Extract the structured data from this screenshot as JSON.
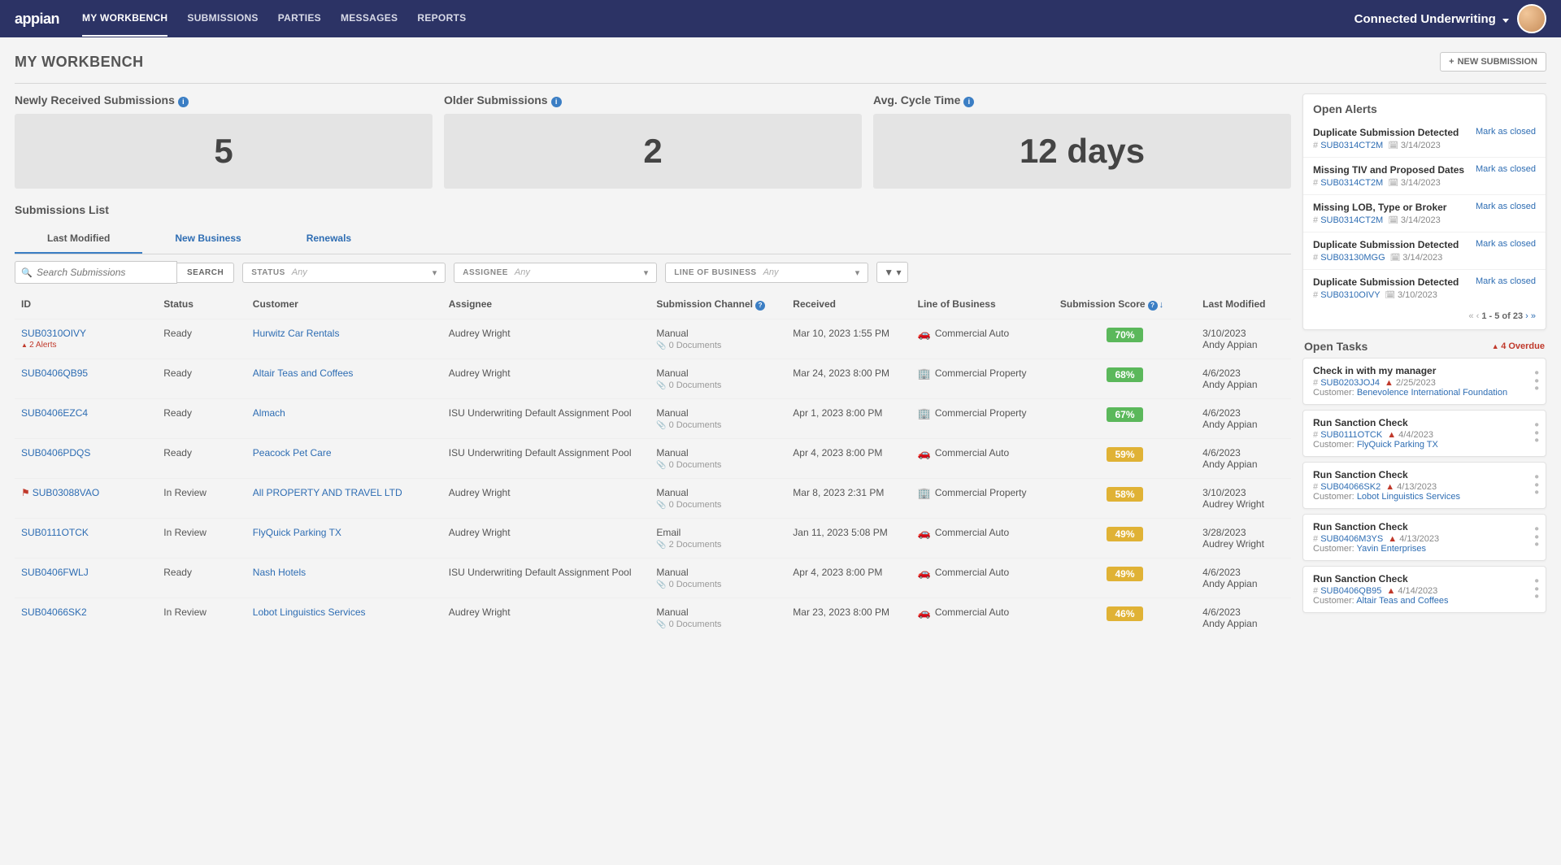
{
  "app": {
    "logo": "appian"
  },
  "nav": {
    "items": [
      {
        "label": "MY WORKBENCH",
        "active": true
      },
      {
        "label": "SUBMISSIONS"
      },
      {
        "label": "PARTIES"
      },
      {
        "label": "MESSAGES"
      },
      {
        "label": "REPORTS"
      }
    ],
    "product": "Connected Underwriting"
  },
  "page": {
    "title": "MY WORKBENCH",
    "new_btn": "NEW SUBMISSION"
  },
  "metrics": {
    "newly": {
      "label": "Newly Received Submissions",
      "value": "5"
    },
    "older": {
      "label": "Older Submissions",
      "value": "2"
    },
    "cycle": {
      "label": "Avg. Cycle Time",
      "value": "12 days"
    }
  },
  "subs": {
    "title": "Submissions List",
    "tabs": [
      {
        "label": "Last Modified",
        "active": true
      },
      {
        "label": "New Business"
      },
      {
        "label": "Renewals"
      }
    ],
    "search_placeholder": "Search Submissions",
    "search_btn": "SEARCH",
    "filters": {
      "status": {
        "label": "STATUS",
        "value": "Any"
      },
      "assignee": {
        "label": "ASSIGNEE",
        "value": "Any"
      },
      "lob": {
        "label": "LINE OF BUSINESS",
        "value": "Any"
      }
    },
    "columns": {
      "id": "ID",
      "status": "Status",
      "customer": "Customer",
      "assignee": "Assignee",
      "channel": "Submission Channel",
      "received": "Received",
      "lob": "Line of Business",
      "score": "Submission Score",
      "modified": "Last Modified"
    },
    "rows": [
      {
        "id": "SUB0310OIVY",
        "alerts": "2 Alerts",
        "status": "Ready",
        "customer": "Hurwitz Car Rentals",
        "assignee": "Audrey Wright",
        "channel": "Manual",
        "docs": "0 Documents",
        "received": "Mar 10, 2023 1:55 PM",
        "lob_icon": "car",
        "lob": "Commercial Auto",
        "score": "70%",
        "score_class": "score-green",
        "mod_date": "3/10/2023",
        "mod_by": "Andy Appian"
      },
      {
        "id": "SUB0406QB95",
        "status": "Ready",
        "customer": "Altair Teas and Coffees",
        "assignee": "Audrey Wright",
        "channel": "Manual",
        "docs": "0 Documents",
        "received": "Mar 24, 2023 8:00 PM",
        "lob_icon": "building",
        "lob": "Commercial Property",
        "score": "68%",
        "score_class": "score-green",
        "mod_date": "4/6/2023",
        "mod_by": "Andy Appian"
      },
      {
        "id": "SUB0406EZC4",
        "status": "Ready",
        "customer": "Almach",
        "assignee": "ISU Underwriting Default Assignment Pool",
        "channel": "Manual",
        "docs": "0 Documents",
        "received": "Apr 1, 2023 8:00 PM",
        "lob_icon": "building",
        "lob": "Commercial Property",
        "score": "67%",
        "score_class": "score-green",
        "mod_date": "4/6/2023",
        "mod_by": "Andy Appian"
      },
      {
        "id": "SUB0406PDQS",
        "status": "Ready",
        "customer": "Peacock Pet Care",
        "assignee": "ISU Underwriting Default Assignment Pool",
        "channel": "Manual",
        "docs": "0 Documents",
        "received": "Apr 4, 2023 8:00 PM",
        "lob_icon": "car",
        "lob": "Commercial Auto",
        "score": "59%",
        "score_class": "score-yellow",
        "mod_date": "4/6/2023",
        "mod_by": "Andy Appian"
      },
      {
        "id": "SUB03088VAO",
        "flag": true,
        "status": "In Review",
        "customer": "All PROPERTY AND TRAVEL LTD",
        "assignee": "Audrey Wright",
        "channel": "Manual",
        "docs": "0 Documents",
        "received": "Mar 8, 2023 2:31 PM",
        "lob_icon": "building",
        "lob": "Commercial Property",
        "score": "58%",
        "score_class": "score-yellow",
        "mod_date": "3/10/2023",
        "mod_by": "Audrey Wright"
      },
      {
        "id": "SUB0111OTCK",
        "status": "In Review",
        "customer": "FlyQuick Parking TX",
        "assignee": "Audrey Wright",
        "channel": "Email",
        "docs": "2 Documents",
        "received": "Jan 11, 2023 5:08 PM",
        "lob_icon": "car",
        "lob": "Commercial Auto",
        "score": "49%",
        "score_class": "score-yellow",
        "mod_date": "3/28/2023",
        "mod_by": "Audrey Wright"
      },
      {
        "id": "SUB0406FWLJ",
        "status": "Ready",
        "customer": "Nash Hotels",
        "assignee": "ISU Underwriting Default Assignment Pool",
        "channel": "Manual",
        "docs": "0 Documents",
        "received": "Apr 4, 2023 8:00 PM",
        "lob_icon": "car",
        "lob": "Commercial Auto",
        "score": "49%",
        "score_class": "score-yellow",
        "mod_date": "4/6/2023",
        "mod_by": "Andy Appian"
      },
      {
        "id": "SUB04066SK2",
        "status": "In Review",
        "customer": "Lobot Linguistics Services",
        "assignee": "Audrey Wright",
        "channel": "Manual",
        "docs": "0 Documents",
        "received": "Mar 23, 2023 8:00 PM",
        "lob_icon": "car",
        "lob": "Commercial Auto",
        "score": "46%",
        "score_class": "score-yellow",
        "mod_date": "4/6/2023",
        "mod_by": "Andy Appian"
      }
    ]
  },
  "alerts": {
    "title": "Open Alerts",
    "mark_closed": "Mark as closed",
    "pagination": "1 - 5 of 23",
    "items": [
      {
        "title": "Duplicate Submission Detected",
        "id": "SUB0314CT2M",
        "date": "3/14/2023"
      },
      {
        "title": "Missing TIV and Proposed Dates",
        "id": "SUB0314CT2M",
        "date": "3/14/2023"
      },
      {
        "title": "Missing LOB, Type or Broker",
        "id": "SUB0314CT2M",
        "date": "3/14/2023"
      },
      {
        "title": "Duplicate Submission Detected",
        "id": "SUB03130MGG",
        "date": "3/14/2023"
      },
      {
        "title": "Duplicate Submission Detected",
        "id": "SUB0310OIVY",
        "date": "3/10/2023"
      }
    ]
  },
  "tasks": {
    "title": "Open Tasks",
    "overdue": "4 Overdue",
    "customer_label": "Customer:",
    "items": [
      {
        "title": "Check in with my manager",
        "id": "SUB0203JOJ4",
        "date": "2/25/2023",
        "customer": "Benevolence International Foundation"
      },
      {
        "title": "Run Sanction Check",
        "id": "SUB0111OTCK",
        "date": "4/4/2023",
        "customer": "FlyQuick Parking TX"
      },
      {
        "title": "Run Sanction Check",
        "id": "SUB04066SK2",
        "date": "4/13/2023",
        "customer": "Lobot Linguistics Services"
      },
      {
        "title": "Run Sanction Check",
        "id": "SUB0406M3YS",
        "date": "4/13/2023",
        "customer": "Yavin Enterprises"
      },
      {
        "title": "Run Sanction Check",
        "id": "SUB0406QB95",
        "date": "4/14/2023",
        "customer": "Altair Teas and Coffees"
      }
    ]
  }
}
